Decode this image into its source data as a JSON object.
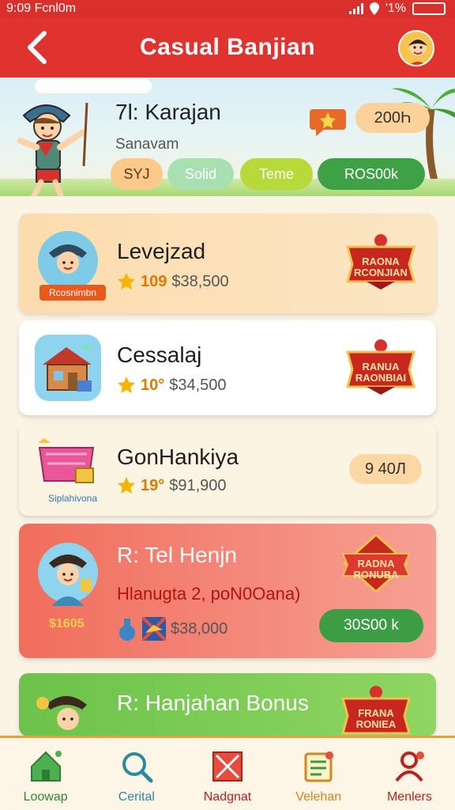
{
  "status_bar": {
    "time": "9:09",
    "carrier": "Fcnl0m",
    "signal_icon": "signal-icon",
    "battery_text": "'1%"
  },
  "header": {
    "title": "Casual Banjian",
    "back_icon": "back-chevron-icon",
    "avatar_icon": "avatar-icon"
  },
  "hero": {
    "title": "7l: Karajan",
    "subtitle": "Sanavam",
    "count": "200Һ",
    "chips": [
      "SYJ",
      "Solid",
      "Teme",
      "ROS00k"
    ]
  },
  "cards": [
    {
      "title": "Levejzad",
      "rating": "10",
      "rating_mark": "9",
      "price": "$38,500",
      "icon_label": "Rcosnimbn",
      "ribbon": "RAONA RCONJIAN"
    },
    {
      "title": "Cessalaj",
      "rating": "10",
      "rating_mark": "°",
      "price": "$34,500",
      "ribbon": "RANUA RAONBIAI"
    },
    {
      "title": "GonHankiya",
      "rating": "19",
      "rating_mark": "°",
      "price": "$91,900",
      "icon_label": "Siplahivona",
      "count": "9 40Л"
    },
    {
      "title": "R: Tel Henjn",
      "subtitle": "Hlanugta 2, poN0Oana)",
      "side_label": "$1605",
      "price": "$38,000",
      "ribbon": "RADNA RONUBA",
      "button": "30S00 k"
    },
    {
      "title": "R: Hanjahan Bonus",
      "ribbon": "FRANA RONIEA"
    }
  ],
  "bottom_nav": [
    {
      "label": "Loowap",
      "icon": "home-icon",
      "color": "#2e8b2e"
    },
    {
      "label": "Cerital",
      "icon": "search-icon",
      "color": "#2a8aa0"
    },
    {
      "label": "Nadgnat",
      "icon": "box-icon",
      "color": "#c0201c"
    },
    {
      "label": "Velehan",
      "icon": "clipboard-icon",
      "color": "#d2861c"
    },
    {
      "label": "Menlers",
      "icon": "profile-icon",
      "color": "#c0201c"
    }
  ],
  "colors": {
    "header": "#e0322e",
    "accent_green": "#3c9d44",
    "accent_orange": "#e9a03a"
  }
}
